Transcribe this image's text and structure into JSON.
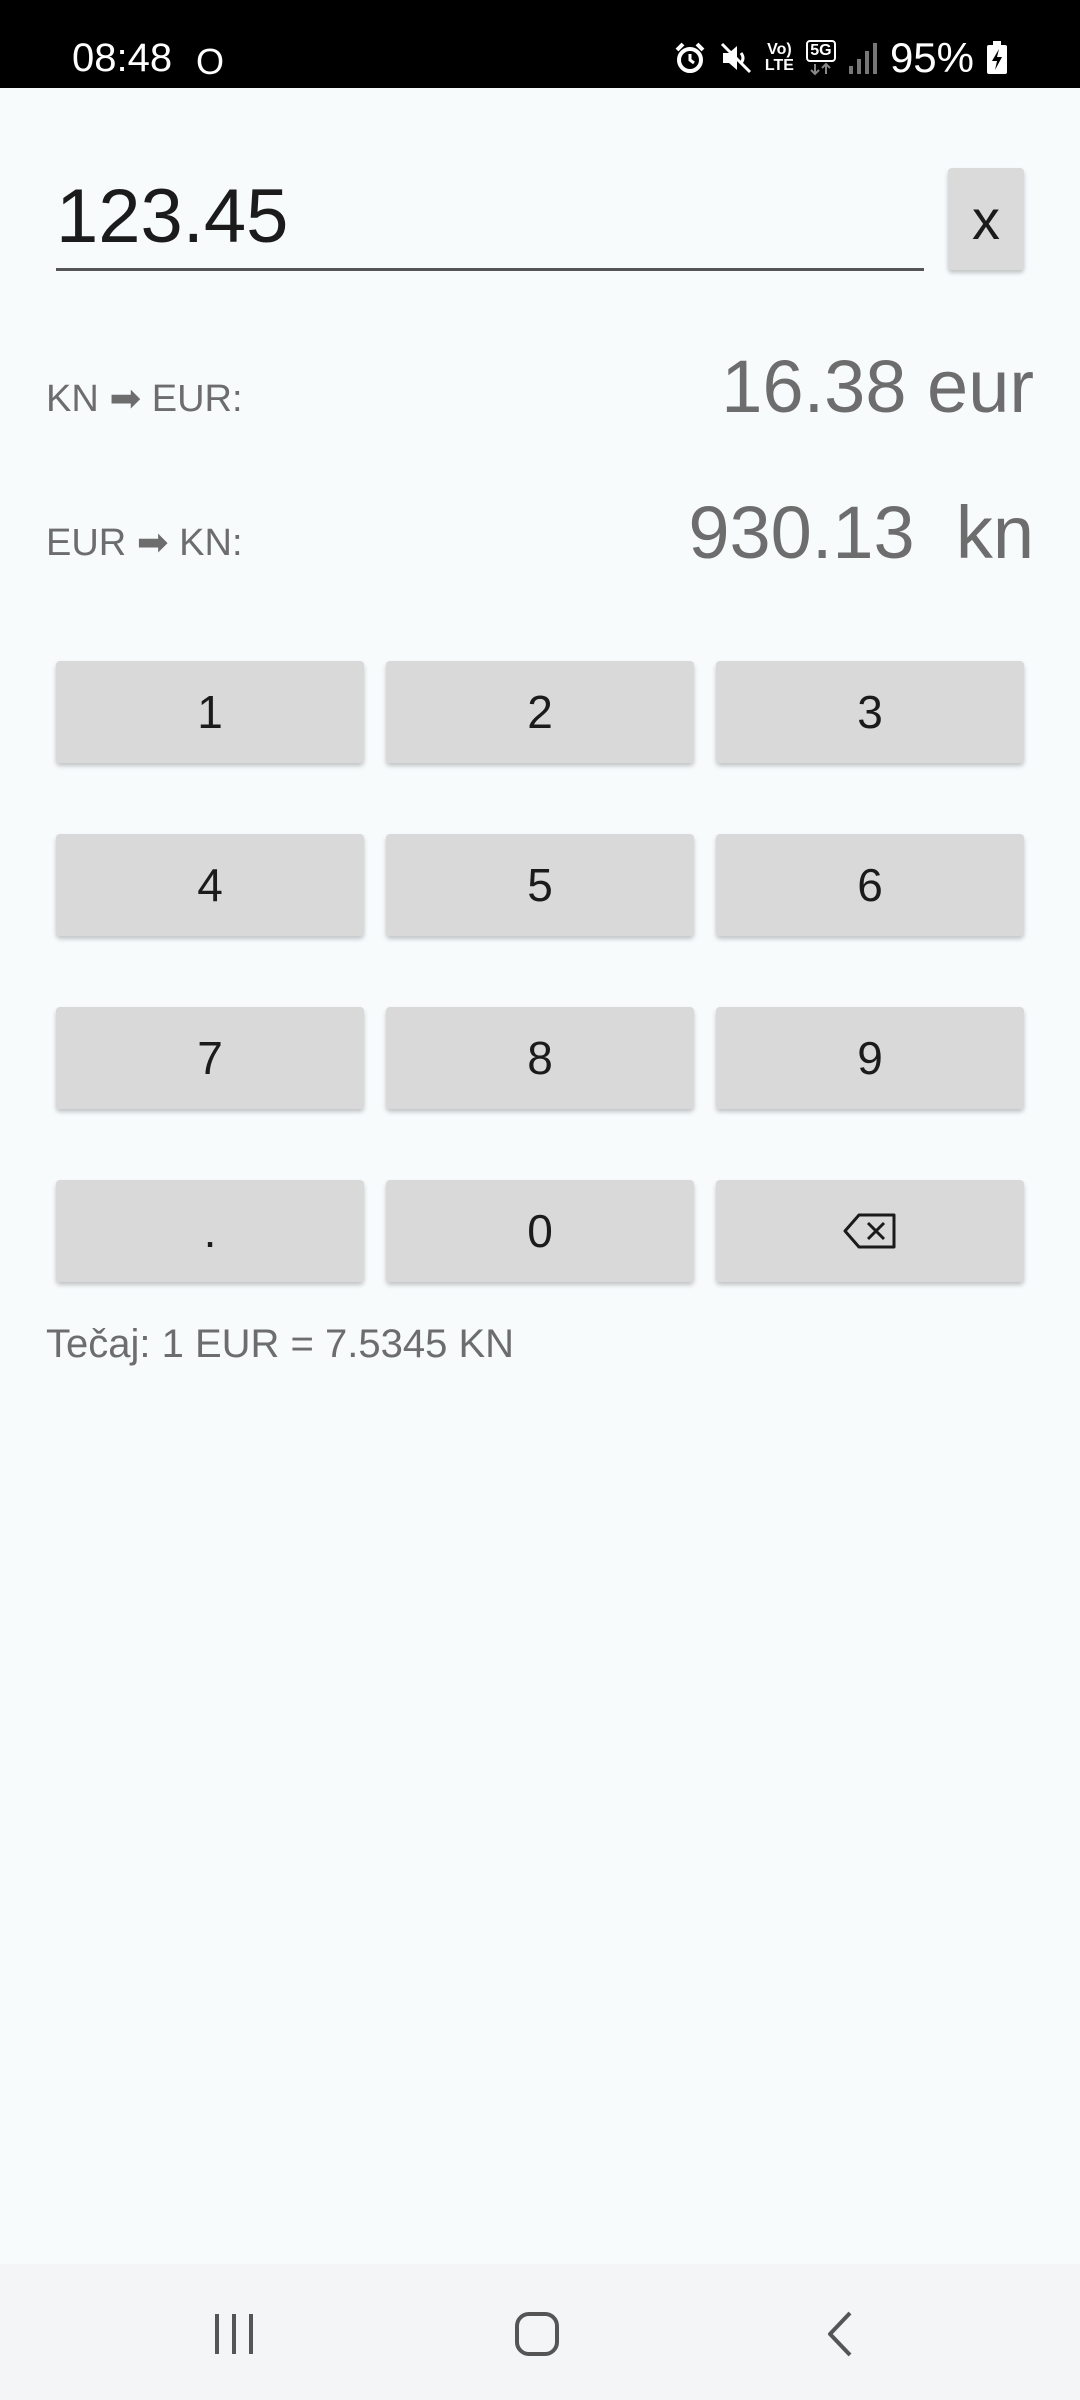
{
  "status_bar": {
    "time": "08:48",
    "notification_glyph": "O",
    "volte_label_top": "Vo)",
    "volte_label_bottom": "LTE",
    "network_label": "5G",
    "battery_percent": "95%",
    "icons": [
      "alarm-icon",
      "mute-icon",
      "volte-icon",
      "5g-icon",
      "signal-icon",
      "battery-charging-icon"
    ]
  },
  "converter": {
    "input_value": "123.45",
    "clear_label": "x",
    "kn_to_eur_label": "KN ➡ EUR:",
    "kn_to_eur_value": "16.38 eur",
    "eur_to_kn_label": "EUR ➡ KN:",
    "eur_to_kn_value": "930.13  kn",
    "rate_text": "Tečaj: 1 EUR = 7.5345 KN"
  },
  "keypad": {
    "keys": [
      "1",
      "2",
      "3",
      "4",
      "5",
      "6",
      "7",
      "8",
      "9",
      ".",
      "0"
    ],
    "backspace_icon": "backspace-icon"
  },
  "nav_bar": {
    "icons": [
      "recent-apps-icon",
      "home-icon",
      "back-icon"
    ]
  },
  "colors": {
    "background": "#f7fbfc",
    "key_background": "#d9d9d9",
    "secondary_text": "#6d6d6d",
    "primary_text": "#1b1b1b"
  }
}
